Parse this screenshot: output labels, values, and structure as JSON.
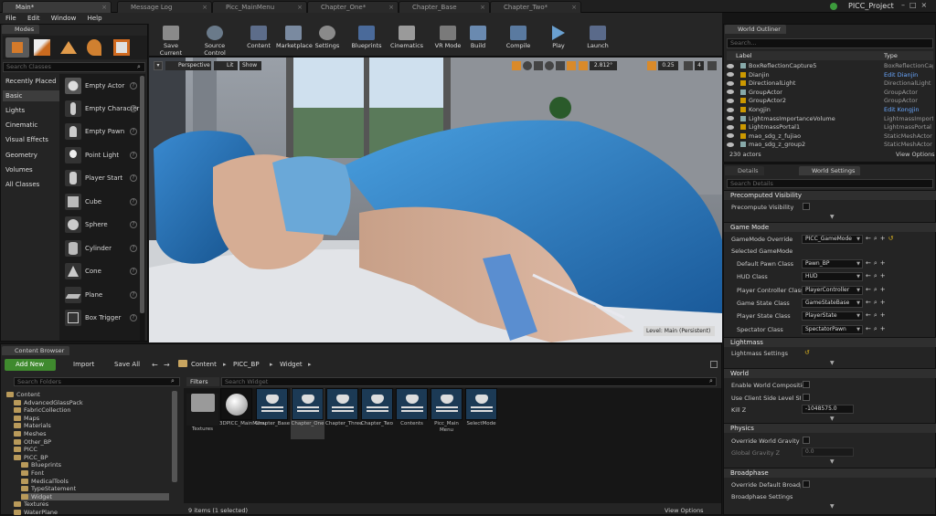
{
  "tabs": [
    {
      "label": "Main*",
      "active": true
    },
    {
      "label": "Message Log",
      "active": false
    },
    {
      "label": "Picc_MainMenu",
      "active": false
    },
    {
      "label": "Chapter_One*",
      "active": false
    },
    {
      "label": "Chapter_Base",
      "active": false
    },
    {
      "label": "Chapter_Two*",
      "active": false
    }
  ],
  "project_name": "PICC_Project",
  "menu": [
    "File",
    "Edit",
    "Window",
    "Help"
  ],
  "modes": {
    "tab": "Modes",
    "search_placeholder": "Search Classes",
    "categories": [
      "Recently Placed",
      "Basic",
      "Lights",
      "Cinematic",
      "Visual Effects",
      "Geometry",
      "Volumes",
      "All Classes"
    ],
    "selected_category": "Basic",
    "classes": [
      "Empty Actor",
      "Empty Character",
      "Empty Pawn",
      "Point Light",
      "Player Start",
      "Cube",
      "Sphere",
      "Cylinder",
      "Cone",
      "Plane",
      "Box Trigger"
    ]
  },
  "toolbar": [
    "Save Current",
    "Source Control",
    "Content",
    "Marketplace",
    "Settings",
    "Blueprints",
    "Cinematics",
    "VR Mode",
    "Build",
    "Compile",
    "Play",
    "Launch"
  ],
  "viewport": {
    "perspective": "Perspective",
    "lit": "Lit",
    "show": "Show",
    "fov": "2.812°",
    "scale": "0.25",
    "grid": "4",
    "level": "Level:  Main (Persistent)"
  },
  "outliner": {
    "tab": "World Outliner",
    "search_placeholder": "Search...",
    "col_label": "Label",
    "col_type": "Type",
    "rows": [
      {
        "label": "BoxReflectionCapture5",
        "type": "BoxReflectionCapture"
      },
      {
        "label": "Dianjin",
        "type": "Edit Dianjin",
        "link": true
      },
      {
        "label": "DirectionalLight",
        "type": "DirectionalLight"
      },
      {
        "label": "GroupActor",
        "type": "GroupActor"
      },
      {
        "label": "GroupActor2",
        "type": "GroupActor"
      },
      {
        "label": "Kongjin",
        "type": "Edit Kongjin",
        "link": true
      },
      {
        "label": "LightmassImportanceVolume",
        "type": "LightmassImportance"
      },
      {
        "label": "LightmassPortal1",
        "type": "LightmassPortal"
      },
      {
        "label": "mao_sdg_z_fujiao",
        "type": "StaticMeshActor"
      },
      {
        "label": "mao_sdg_z_group2",
        "type": "StaticMeshActor"
      }
    ],
    "count": "230 actors",
    "view_options": "View Options"
  },
  "details": {
    "tab1": "Details",
    "tab2": "World Settings",
    "search_placeholder": "Search Details",
    "sections": {
      "precomputed": "Precomputed Visibility",
      "gamemode": "Game Mode",
      "lightmass": "Lightmass",
      "world": "World",
      "physics": "Physics",
      "broadphase": "Broadphase"
    },
    "precompute_visibility": "Precompute Visibility",
    "gamemode_override": "GameMode Override",
    "gamemode_value": "PICC_GameMode",
    "selected_gamemode": "Selected GameMode",
    "gm_rows": [
      {
        "label": "Default Pawn Class",
        "value": "Pawn_BP"
      },
      {
        "label": "HUD Class",
        "value": "HUD"
      },
      {
        "label": "Player Controller Class",
        "value": "PlayerController"
      },
      {
        "label": "Game State Class",
        "value": "GameStateBase"
      },
      {
        "label": "Player State Class",
        "value": "PlayerState"
      },
      {
        "label": "Spectator Class",
        "value": "SpectatorPawn"
      }
    ],
    "lightmass_settings": "Lightmass Settings",
    "enable_world_composition": "Enable World Composition",
    "use_client_side": "Use Client Side Level Streaming",
    "kill_z": "Kill Z",
    "kill_z_value": "-1048575.0",
    "override_gravity": "Override World Gravity",
    "global_gravity": "Global Gravity Z",
    "global_gravity_value": "0.0",
    "override_broadphase": "Override Default Broadphase",
    "broadphase_settings": "Broadphase Settings"
  },
  "content_browser": {
    "tab": "Content Browser",
    "add_new": "Add New",
    "import": "Import",
    "save_all": "Save All",
    "breadcrumb": [
      "Content",
      "PICC_BP",
      "Widget"
    ],
    "search_folders": "Search Folders",
    "filters": "Filters",
    "search_widget": "Search Widget",
    "tree": [
      {
        "label": "Content",
        "depth": 0
      },
      {
        "label": "AdvancedGlassPack",
        "depth": 1
      },
      {
        "label": "FabricCollection",
        "depth": 1
      },
      {
        "label": "Maps",
        "depth": 1
      },
      {
        "label": "Materials",
        "depth": 1
      },
      {
        "label": "Meshes",
        "depth": 1
      },
      {
        "label": "Other_BP",
        "depth": 1
      },
      {
        "label": "PICC",
        "depth": 1
      },
      {
        "label": "PICC_BP",
        "depth": 1
      },
      {
        "label": "Blueprints",
        "depth": 2
      },
      {
        "label": "Font",
        "depth": 2
      },
      {
        "label": "MedicalTools",
        "depth": 2
      },
      {
        "label": "TypeStatement",
        "depth": 2
      },
      {
        "label": "Widget",
        "depth": 2,
        "selected": true
      },
      {
        "label": "Textures",
        "depth": 1
      },
      {
        "label": "WaterPlane",
        "depth": 1
      }
    ],
    "assets": [
      "Textures",
      "3DPICC_MainMenu",
      "Chapter_Base",
      "Chapter_One",
      "Chapter_Three",
      "Chapter_Two",
      "Contents",
      "Picc_Main Menu",
      "SelectMode"
    ],
    "status": "9 items (1 selected)",
    "view_options": "View Options"
  }
}
